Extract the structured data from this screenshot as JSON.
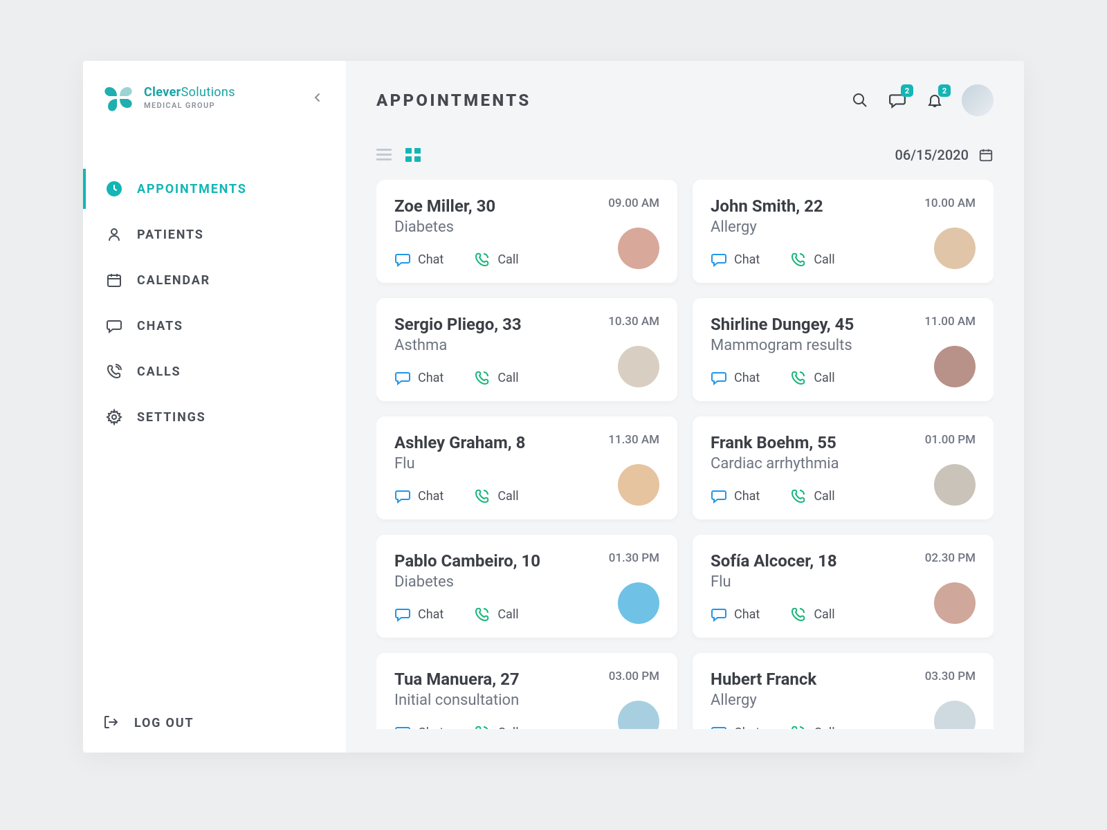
{
  "brand": {
    "title_bold": "Clever",
    "title_rest": "Solutions",
    "subtitle": "MEDICAL GROUP"
  },
  "nav": {
    "appointments": "APPOINTMENTS",
    "patients": "PATIENTS",
    "calendar": "CALENDAR",
    "chats": "CHATS",
    "calls": "CALLS",
    "settings": "SETTINGS",
    "logout": "LOG OUT"
  },
  "header": {
    "title": "APPOINTMENTS",
    "messages_badge": "2",
    "notifications_badge": "2",
    "date": "06/15/2020"
  },
  "actions": {
    "chat": "Chat",
    "call": "Call"
  },
  "appointments": [
    {
      "name": "Zoe Miller, 30",
      "reason": "Diabetes",
      "time": "09.00 AM"
    },
    {
      "name": "John Smith, 22",
      "reason": "Allergy",
      "time": "10.00 AM"
    },
    {
      "name": "Sergio Pliego, 33",
      "reason": "Asthma",
      "time": "10.30 AM"
    },
    {
      "name": "Shirline Dungey, 45",
      "reason": "Mammogram results",
      "time": "11.00 AM"
    },
    {
      "name": "Ashley Graham, 8",
      "reason": "Flu",
      "time": "11.30 AM"
    },
    {
      "name": "Frank Boehm, 55",
      "reason": "Cardiac arrhythmia",
      "time": "01.00 PM"
    },
    {
      "name": "Pablo Cambeiro, 10",
      "reason": "Diabetes",
      "time": "01.30 PM"
    },
    {
      "name": "Sofía Alcocer, 18",
      "reason": "Flu",
      "time": "02.30 PM"
    },
    {
      "name": "Tua Manuera, 27",
      "reason": "Initial consultation",
      "time": "03.00 PM"
    },
    {
      "name": "Hubert Franck",
      "reason": "Allergy",
      "time": "03.30 PM"
    }
  ]
}
